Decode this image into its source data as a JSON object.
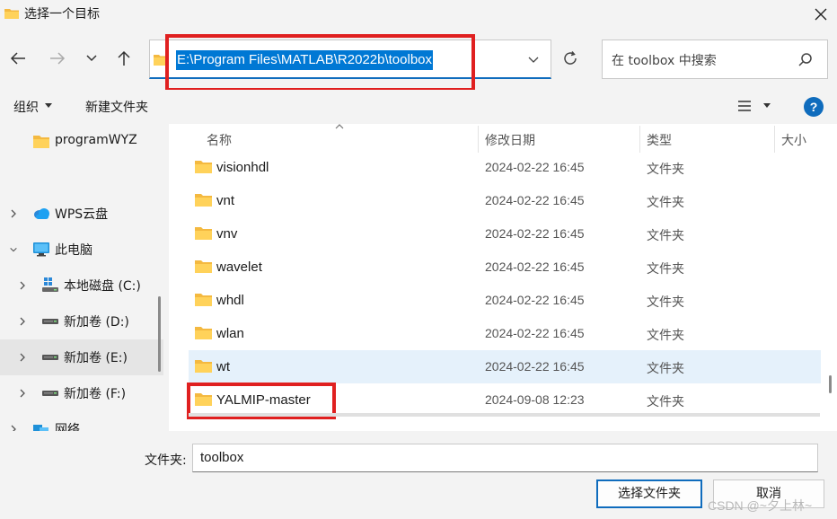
{
  "window": {
    "title": "选择一个目标"
  },
  "address_bar": {
    "path": "E:\\Program Files\\MATLAB\\R2022b\\toolbox"
  },
  "search": {
    "placeholder": "在 toolbox 中搜索"
  },
  "toolbar": {
    "organize_label": "组织",
    "new_folder_label": "新建文件夹",
    "help_label": "?"
  },
  "sidebar": {
    "items": [
      {
        "label": "programWYZ",
        "icon": "folder-icon"
      },
      {
        "label": "WPS云盘",
        "icon": "cloud-icon"
      },
      {
        "label": "此电脑",
        "icon": "computer-icon"
      },
      {
        "label": "本地磁盘 (C:)",
        "icon": "windows-drive-icon"
      },
      {
        "label": "新加卷 (D:)",
        "icon": "drive-icon"
      },
      {
        "label": "新加卷 (E:)",
        "icon": "drive-icon",
        "selected": true
      },
      {
        "label": "新加卷 (F:)",
        "icon": "drive-icon"
      },
      {
        "label": "网络",
        "icon": "network-icon"
      }
    ]
  },
  "file_list": {
    "columns": [
      "名称",
      "修改日期",
      "类型",
      "大小"
    ],
    "rows": [
      {
        "name": "visionhdl",
        "modified": "2024-02-22 16:45",
        "type": "文件夹"
      },
      {
        "name": "vnt",
        "modified": "2024-02-22 16:45",
        "type": "文件夹"
      },
      {
        "name": "vnv",
        "modified": "2024-02-22 16:45",
        "type": "文件夹"
      },
      {
        "name": "wavelet",
        "modified": "2024-02-22 16:45",
        "type": "文件夹"
      },
      {
        "name": "whdl",
        "modified": "2024-02-22 16:45",
        "type": "文件夹"
      },
      {
        "name": "wlan",
        "modified": "2024-02-22 16:45",
        "type": "文件夹"
      },
      {
        "name": "wt",
        "modified": "2024-02-22 16:45",
        "type": "文件夹",
        "hovered": true
      },
      {
        "name": "YALMIP-master",
        "modified": "2024-09-08 12:23",
        "type": "文件夹"
      }
    ]
  },
  "footer": {
    "folder_label": "文件夹:",
    "folder_value": "toolbox",
    "select_button": "选择文件夹",
    "cancel_button": "取消",
    "watermark": "CSDN @~夕上林~"
  },
  "colors": {
    "accent": "#0f6cbd",
    "selection": "#0078d4",
    "highlight_box": "#e02020",
    "hover_row": "#e5f1fb"
  }
}
